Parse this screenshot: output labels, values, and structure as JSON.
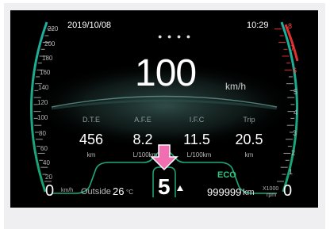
{
  "status": {
    "date": "2019/10/08",
    "time": "10:29"
  },
  "speed": {
    "value": "100",
    "unit": "km/h"
  },
  "speed_scale": [
    "220",
    "200",
    "180",
    "160",
    "140",
    "120",
    "100",
    "80",
    "60",
    "40",
    "20",
    "0"
  ],
  "speed_scale_unit": "km/h",
  "rpm_scale": [
    "8",
    "7",
    "6",
    "5",
    "4",
    "3",
    "2",
    "1",
    "0"
  ],
  "rpm_unit_top": "X1000",
  "rpm_unit_bottom": "rpm",
  "trip_info": [
    {
      "label": "D.T.E",
      "value": "456",
      "unit": "km"
    },
    {
      "label": "A.F.E",
      "value": "8.2",
      "unit": "L/100km"
    },
    {
      "label": "I.F.C",
      "value": "11.5",
      "unit": "L/100km"
    },
    {
      "label": "Trip",
      "value": "20.5",
      "unit": "km"
    }
  ],
  "gear": "5",
  "eco_label": "ECO",
  "outside_temp": {
    "label": "Outside",
    "value": "26",
    "unit": "°C"
  },
  "odometer": {
    "value": "999999",
    "unit": "km"
  },
  "colors": {
    "accent": "#1fc28a",
    "redline": "#e0302e",
    "highlight_arrow": "#f06fb0",
    "eco": "#2ec77d"
  }
}
